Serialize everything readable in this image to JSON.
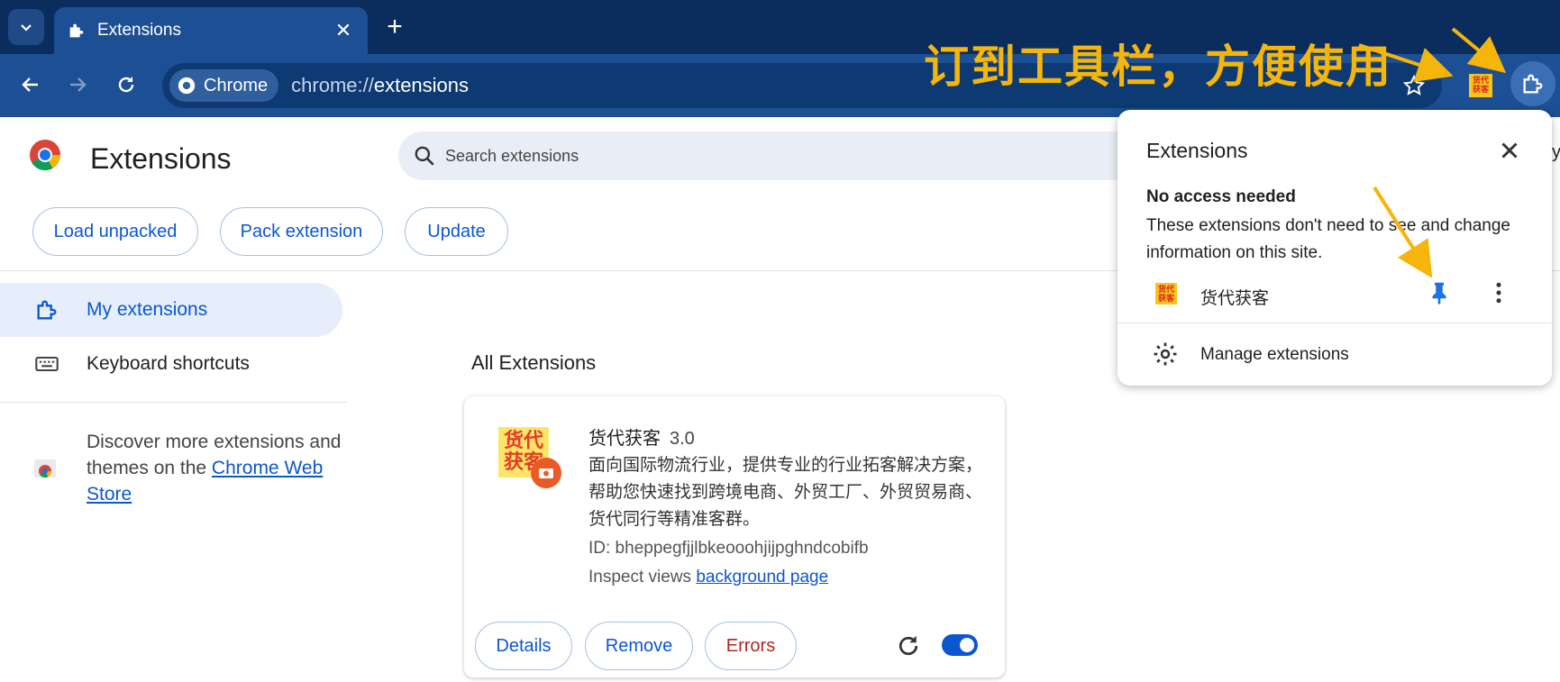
{
  "tabstrip": {
    "tab_title": "Extensions",
    "close_glyph": "✕",
    "new_tab_glyph": "+"
  },
  "toolbar": {
    "chip_label": "Chrome",
    "url_scheme": "chrome://",
    "url_host": "extensions",
    "toolbar_extension_icon_text": "货代获客"
  },
  "annotation": {
    "text": "订到工具栏，方便使用",
    "color": "#f5b50a"
  },
  "header": {
    "title": "Extensions",
    "search_placeholder": "Search extensions",
    "buttons": [
      "Load unpacked",
      "Pack extension",
      "Update"
    ]
  },
  "sidebar": {
    "items": [
      {
        "label": "My extensions",
        "icon": "extension-icon",
        "active": true
      },
      {
        "label": "Keyboard shortcuts",
        "icon": "keyboard-icon",
        "active": false
      }
    ],
    "discover_text": "Discover more extensions and themes on the ",
    "discover_link": "Chrome Web Store"
  },
  "main": {
    "section_title": "All Extensions",
    "extension": {
      "icon_text_line1": "货代",
      "icon_text_line2": "获客",
      "name": "货代获客",
      "version": "3.0",
      "description": "面向国际物流行业，提供专业的行业拓客解决方案，帮助您快速找到跨境电商、外贸工厂、外贸贸易商、货代同行等精准客群。",
      "id_text": "ID: bheppegfjjlbkeooohjijpghndcobifb",
      "inspect_label": "Inspect views ",
      "inspect_link": "background page",
      "buttons": {
        "details": "Details",
        "remove": "Remove",
        "errors": "Errors"
      },
      "enabled": true
    }
  },
  "popup": {
    "title": "Extensions",
    "subtitle": "No access needed",
    "note": "These extensions don't need to see and change information on this site.",
    "item_name": "货代获客",
    "item_icon_text": "货代获客",
    "manage_label": "Manage extensions",
    "edge_text": "y"
  },
  "colors": {
    "accent": "#0b57d0",
    "frame": "#1c4f93",
    "error": "#b3261e"
  }
}
